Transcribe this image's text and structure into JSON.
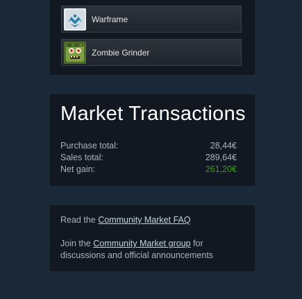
{
  "games": [
    {
      "name": "Warframe",
      "icon": "warframe-logo-icon"
    },
    {
      "name": "Zombie Grinder",
      "icon": "zombie-grinder-icon"
    }
  ],
  "transactions": {
    "title": "Market Transactions",
    "rows": [
      {
        "label": "Purchase total:",
        "value": "28,44€"
      },
      {
        "label": "Sales total:",
        "value": "289,64€"
      },
      {
        "label": "Net gain:",
        "value": "261,20€"
      }
    ]
  },
  "links": {
    "faq_prefix": "Read the ",
    "faq_link": "Community Market FAQ",
    "group_prefix": "Join the ",
    "group_link": "Community Market group",
    "group_suffix": " for discussions and official announcements"
  },
  "colors": {
    "background": "#1b2838",
    "panel": "#111822",
    "net_gain": "#3f9b1d"
  }
}
